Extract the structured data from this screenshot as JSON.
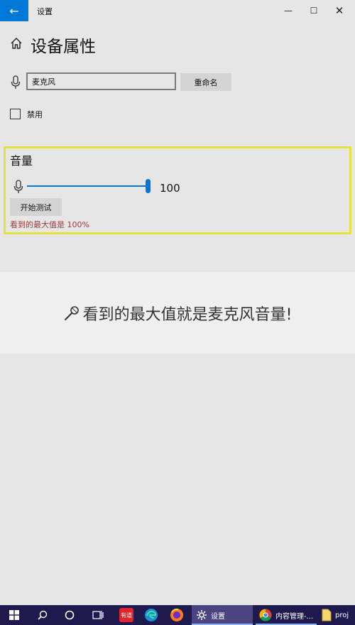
{
  "window": {
    "title": "设置",
    "back_glyph": "←",
    "min_glyph": "—",
    "max_glyph": "☐",
    "close_glyph": "✕"
  },
  "page": {
    "title": "设备属性"
  },
  "name_row": {
    "input_value": "麦克风",
    "rename_label": "重命名"
  },
  "disable": {
    "label": "禁用",
    "checked": false
  },
  "volume": {
    "title": "音量",
    "level": 100,
    "value_text": "100",
    "test_button_label": "开始测试",
    "max_value_text": "看到的最大值是 100%"
  },
  "caption": {
    "text": "看到的最大值就是麦克风音量!"
  },
  "taskbar": {
    "app_red_label": "有道",
    "settings_label": "设置",
    "chrome_label": "内容管理-...",
    "folder_label": "proj"
  },
  "colors": {
    "accent": "#0078d7",
    "highlight_border": "#e3e33a",
    "warning_text": "#a23a3a",
    "taskbar_bg": "#1f1a4d"
  }
}
